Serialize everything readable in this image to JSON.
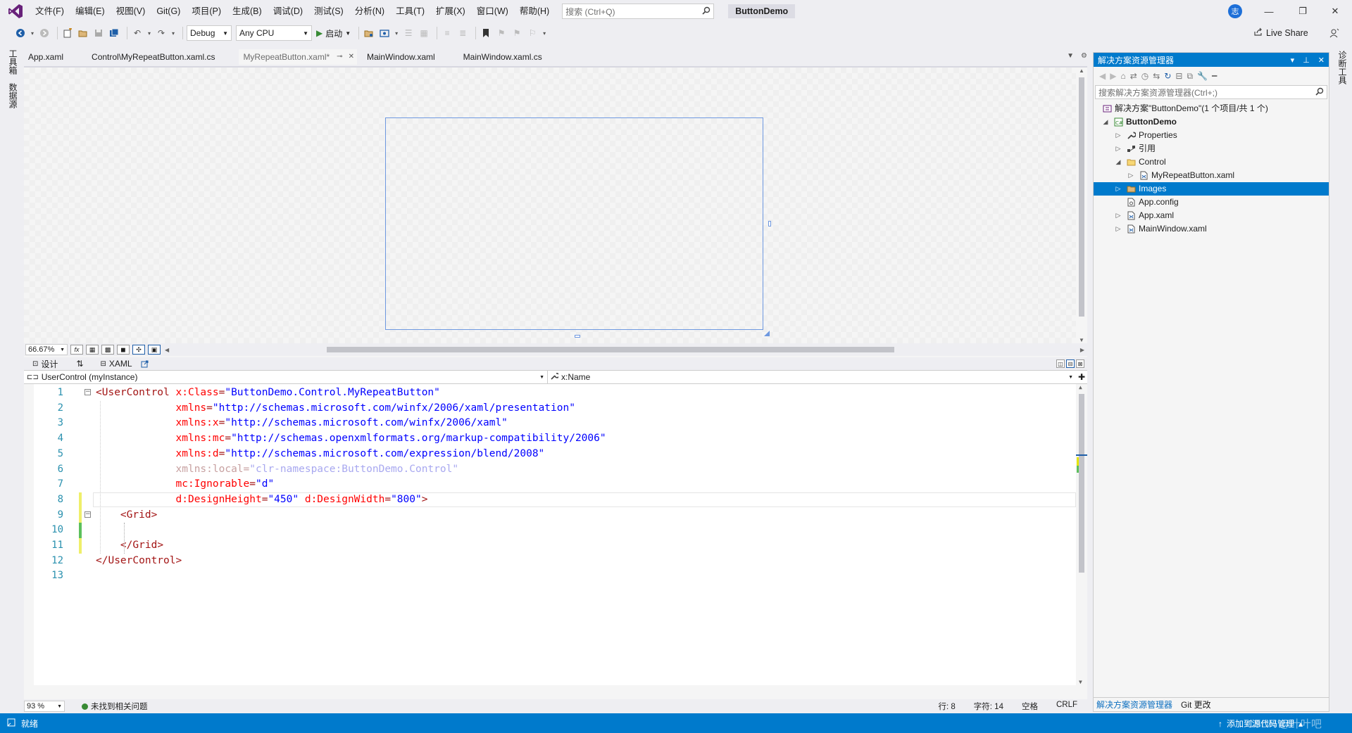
{
  "titlebar": {
    "menu": [
      "文件(F)",
      "编辑(E)",
      "视图(V)",
      "Git(G)",
      "项目(P)",
      "生成(B)",
      "调试(D)",
      "测试(S)",
      "分析(N)",
      "工具(T)",
      "扩展(X)",
      "窗口(W)",
      "帮助(H)"
    ],
    "search_placeholder": "搜索 (Ctrl+Q)",
    "solution_name": "ButtonDemo",
    "avatar_initial": "志",
    "minimize": "—",
    "restore": "❐",
    "close": "✕"
  },
  "toolbar": {
    "config": "Debug",
    "platform": "Any CPU",
    "start_label": "启动",
    "liveshare_label": "Live Share"
  },
  "left_strip": {
    "toolbox": "工具箱",
    "datasource": "数据源"
  },
  "right_strip": {
    "diagnostics": "诊断工具"
  },
  "tabs": [
    {
      "label": "App.xaml",
      "active": false
    },
    {
      "label": "Control\\MyRepeatButton.xaml.cs",
      "active": false
    },
    {
      "label": "MyRepeatButton.xaml*",
      "active": true
    },
    {
      "label": "MainWindow.xaml",
      "active": false
    },
    {
      "label": "MainWindow.xaml.cs",
      "active": false
    }
  ],
  "designer": {
    "zoom": "66.67%",
    "fx_label": "fx"
  },
  "split": {
    "design_tab": "设计",
    "swap": "⇅",
    "xaml_tab": "XAML"
  },
  "navbar": {
    "left": "UserControl (myInstance)",
    "right": "x:Name"
  },
  "code": {
    "line_numbers": [
      "1",
      "2",
      "3",
      "4",
      "5",
      "6",
      "7",
      "8",
      "9",
      "10",
      "11",
      "12",
      "13"
    ],
    "lines": [
      [
        [
          "b",
          "<"
        ],
        [
          "e",
          "UserControl"
        ],
        [
          "s",
          " "
        ],
        [
          "a",
          "x:Class"
        ],
        [
          "b",
          "="
        ],
        [
          "v",
          "\"ButtonDemo.Control.MyRepeatButton\""
        ]
      ],
      [
        [
          "s",
          "             "
        ],
        [
          "a",
          "xmlns"
        ],
        [
          "b",
          "="
        ],
        [
          "v",
          "\"http://schemas.microsoft.com/winfx/2006/xaml/presentation\""
        ]
      ],
      [
        [
          "s",
          "             "
        ],
        [
          "a",
          "xmlns:x"
        ],
        [
          "b",
          "="
        ],
        [
          "v",
          "\"http://schemas.microsoft.com/winfx/2006/xaml\""
        ]
      ],
      [
        [
          "s",
          "             "
        ],
        [
          "a",
          "xmlns:mc"
        ],
        [
          "b",
          "="
        ],
        [
          "v",
          "\"http://schemas.openxmlformats.org/markup-compatibility/2006\""
        ]
      ],
      [
        [
          "s",
          "             "
        ],
        [
          "a",
          "xmlns:d"
        ],
        [
          "b",
          "="
        ],
        [
          "v",
          "\"http://schemas.microsoft.com/expression/blend/2008\""
        ]
      ],
      [
        [
          "s",
          "             "
        ],
        [
          "da",
          "xmlns:local"
        ],
        [
          "da",
          "="
        ],
        [
          "dv",
          "\"clr-namespace:ButtonDemo.Control\""
        ]
      ],
      [
        [
          "s",
          "             "
        ],
        [
          "a",
          "mc:Ignorable"
        ],
        [
          "b",
          "="
        ],
        [
          "v",
          "\"d\""
        ]
      ],
      [
        [
          "s",
          "             "
        ],
        [
          "a",
          "d:DesignHeight"
        ],
        [
          "b",
          "="
        ],
        [
          "v",
          "\"450\""
        ],
        [
          "s",
          " "
        ],
        [
          "a",
          "d:DesignWidth"
        ],
        [
          "b",
          "="
        ],
        [
          "v",
          "\"800\""
        ],
        [
          "b",
          ">"
        ]
      ],
      [
        [
          "s",
          "    "
        ],
        [
          "b",
          "<"
        ],
        [
          "e",
          "Grid"
        ],
        [
          "b",
          ">"
        ]
      ],
      [
        [
          "s",
          ""
        ]
      ],
      [
        [
          "s",
          "    "
        ],
        [
          "b",
          "</"
        ],
        [
          "e",
          "Grid"
        ],
        [
          "b",
          ">"
        ]
      ],
      [
        [
          "b",
          "</"
        ],
        [
          "e",
          "UserControl"
        ],
        [
          "b",
          ">"
        ]
      ],
      [
        [
          "s",
          ""
        ]
      ]
    ]
  },
  "editor_status": {
    "zoom": "93 %",
    "issues": "未找到相关问题",
    "line": "行: 8",
    "char": "字符: 14",
    "space": "空格",
    "eol": "CRLF"
  },
  "solution_explorer": {
    "title": "解决方案资源管理器",
    "search_placeholder": "搜索解决方案资源管理器(Ctrl+;)",
    "tree": [
      {
        "label": "解决方案\"ButtonDemo\"(1 个项目/共 1 个)",
        "depth": 0,
        "arrow": "",
        "icon": "solution",
        "selected": false,
        "bold": false
      },
      {
        "label": "ButtonDemo",
        "depth": 0,
        "arrow": "◢",
        "icon": "csproj",
        "selected": false,
        "bold": true
      },
      {
        "label": "Properties",
        "depth": 1,
        "arrow": "▷",
        "icon": "wrench",
        "selected": false,
        "bold": false
      },
      {
        "label": "引用",
        "depth": 1,
        "arrow": "▷",
        "icon": "refs",
        "selected": false,
        "bold": false
      },
      {
        "label": "Control",
        "depth": 1,
        "arrow": "◢",
        "icon": "folder-open",
        "selected": false,
        "bold": false
      },
      {
        "label": "MyRepeatButton.xaml",
        "depth": 2,
        "arrow": "▷",
        "icon": "xaml",
        "selected": false,
        "bold": false
      },
      {
        "label": "Images",
        "depth": 1,
        "arrow": "▷",
        "icon": "folder",
        "selected": true,
        "bold": false
      },
      {
        "label": "App.config",
        "depth": 1,
        "arrow": "",
        "icon": "config",
        "selected": false,
        "bold": false
      },
      {
        "label": "App.xaml",
        "depth": 1,
        "arrow": "▷",
        "icon": "xaml",
        "selected": false,
        "bold": false
      },
      {
        "label": "MainWindow.xaml",
        "depth": 1,
        "arrow": "▷",
        "icon": "xaml",
        "selected": false,
        "bold": false
      }
    ],
    "bottom_tabs": [
      "解决方案资源管理器",
      "Git 更改"
    ]
  },
  "statusbar": {
    "ready": "就绪",
    "source_control": "添加到源代码管理",
    "watermark": "CSDN @叶叶吧"
  },
  "colors": {
    "accent": "#007acc",
    "xml_attr": "#ff0000",
    "xml_value": "#0000ff",
    "xml_element": "#a31515",
    "line_number": "#2b91af"
  }
}
